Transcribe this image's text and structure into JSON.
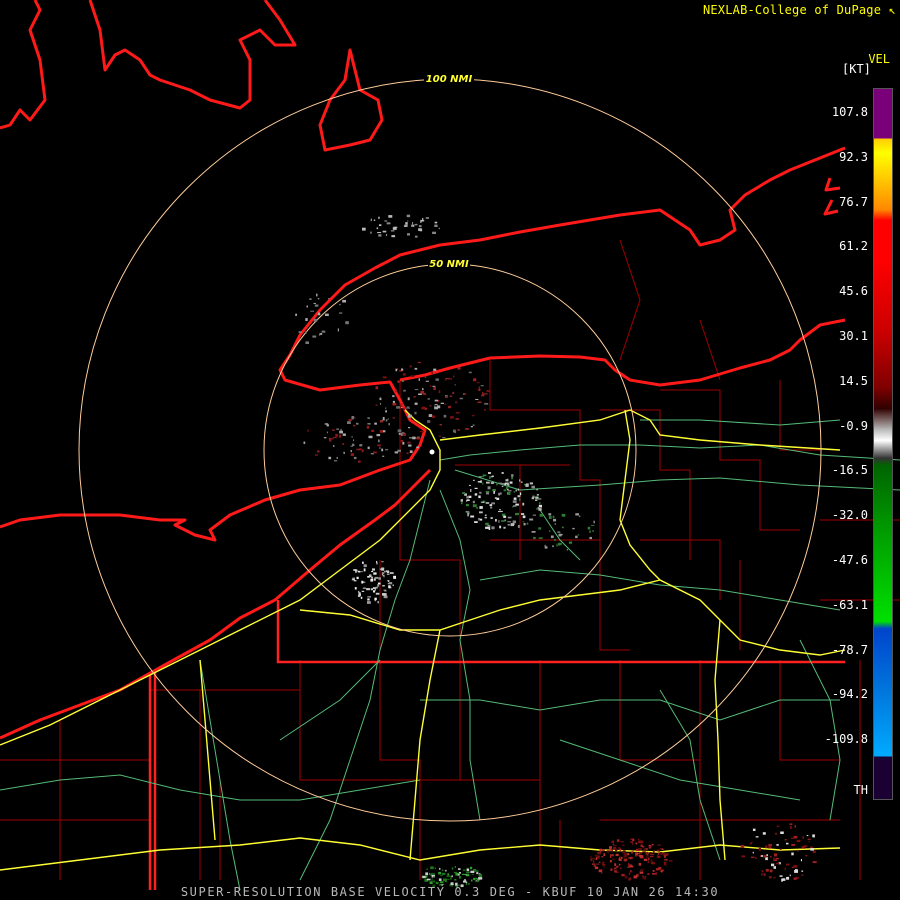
{
  "header": {
    "credit": "NEXLAB-College of DuPage ↖"
  },
  "footer": {
    "product": "SUPER-RESOLUTION BASE VELOCITY 0.3 DEG - KBUF 10 JAN 26 14:30"
  },
  "range_rings": {
    "outer_label": "100 NMI",
    "inner_label": "50 NMI"
  },
  "velocity_scale": {
    "title": "VEL",
    "unit": "[KT]",
    "ticks": [
      "107.8",
      "92.3",
      "76.7",
      "61.2",
      "45.6",
      "30.1",
      "14.5",
      "-0.9",
      "-16.5",
      "-32.0",
      "-47.6",
      "-63.1",
      "-78.7",
      "-94.2",
      "-109.8",
      "TH"
    ],
    "colors": {
      "purple": "#7a007a",
      "yellow": "#ffff00",
      "red": "#ff0000",
      "dark_red": "#800000",
      "gray": "#bbbbbb",
      "dark_green": "#006400",
      "green": "#00e000",
      "blue": "#0044cc",
      "cyan": "#00aaff",
      "range_folded": "#1a0033"
    }
  },
  "map_colors": {
    "coastline": "#ff1a1a",
    "county_lines": "#b00000",
    "interstates": "#ffff33",
    "highways": "#66cc88",
    "range_rings": "#ffcc99"
  }
}
